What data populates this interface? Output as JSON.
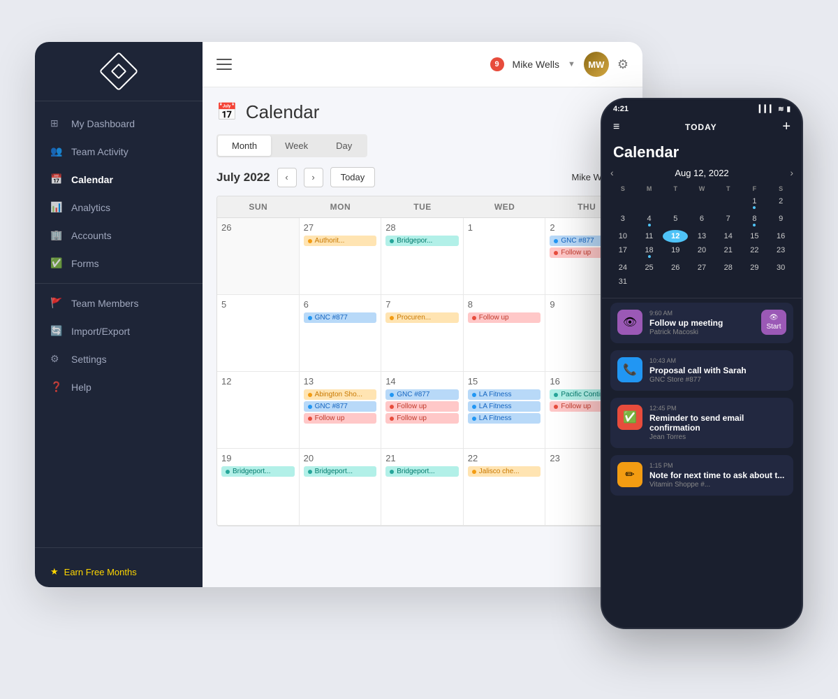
{
  "app": {
    "title": "Calendar"
  },
  "sidebar": {
    "logo_label": "App Logo",
    "nav_items": [
      {
        "id": "dashboard",
        "label": "My Dashboard",
        "icon": "⊞"
      },
      {
        "id": "team-activity",
        "label": "Team Activity",
        "icon": "👥",
        "active": false
      },
      {
        "id": "calendar",
        "label": "Calendar",
        "icon": "📅",
        "active": true
      },
      {
        "id": "analytics",
        "label": "Analytics",
        "icon": "📊"
      },
      {
        "id": "accounts",
        "label": "Accounts",
        "icon": "🏢"
      },
      {
        "id": "forms",
        "label": "Forms",
        "icon": "✅"
      }
    ],
    "bottom_items": [
      {
        "id": "team-members",
        "label": "Team Members",
        "icon": "👥"
      },
      {
        "id": "import-export",
        "label": "Import/Export",
        "icon": "🔄"
      },
      {
        "id": "settings",
        "label": "Settings",
        "icon": "⚙"
      },
      {
        "id": "help",
        "label": "Help",
        "icon": "❓"
      }
    ],
    "earn_label": "Earn Free Months"
  },
  "topbar": {
    "notification_count": "9",
    "user_name": "Mike Wells",
    "user_initials": "MW"
  },
  "calendar": {
    "title": "Calendar",
    "tabs": [
      "Month",
      "Week",
      "Day"
    ],
    "active_tab": "Month",
    "current_month": "July 2022",
    "today_label": "Today",
    "filter_user": "Mike Wells",
    "day_headers": [
      "SUN",
      "MON",
      "TUE",
      "WED",
      "THU"
    ],
    "weeks": [
      {
        "days": [
          {
            "date": "26",
            "other_month": true,
            "events": []
          },
          {
            "date": "27",
            "events": [
              {
                "label": "Authorit...",
                "type": "orange"
              }
            ]
          },
          {
            "date": "28",
            "events": [
              {
                "label": "Bridgepor...",
                "type": "teal"
              }
            ]
          },
          {
            "date": "1",
            "events": []
          },
          {
            "date": "2",
            "events": [
              {
                "label": "GNC #877",
                "type": "blue"
              },
              {
                "label": "Follow up",
                "type": "red"
              }
            ]
          }
        ]
      },
      {
        "days": [
          {
            "date": "5",
            "events": []
          },
          {
            "date": "6",
            "events": [
              {
                "label": "GNC #877",
                "type": "blue"
              }
            ]
          },
          {
            "date": "7",
            "events": [
              {
                "label": "Procuren...",
                "type": "orange"
              }
            ]
          },
          {
            "date": "8",
            "events": [
              {
                "label": "Follow up",
                "type": "red"
              }
            ]
          },
          {
            "date": "9",
            "events": []
          }
        ]
      },
      {
        "days": [
          {
            "date": "12",
            "events": []
          },
          {
            "date": "13",
            "events": [
              {
                "label": "Abington Sho...",
                "type": "orange"
              },
              {
                "label": "GNC #877",
                "type": "blue"
              },
              {
                "label": "Follow up",
                "type": "red"
              }
            ]
          },
          {
            "date": "14",
            "events": [
              {
                "label": "GNC #877",
                "type": "blue"
              },
              {
                "label": "Follow up",
                "type": "red"
              },
              {
                "label": "Follow up",
                "type": "red"
              }
            ]
          },
          {
            "date": "15",
            "events": [
              {
                "label": "LA Fitness",
                "type": "blue"
              },
              {
                "label": "LA Fitness",
                "type": "blue"
              },
              {
                "label": "LA Fitness",
                "type": "blue"
              }
            ]
          },
          {
            "date": "16",
            "events": [
              {
                "label": "Pacific Contin...",
                "type": "teal"
              },
              {
                "label": "Follow up",
                "type": "red"
              }
            ]
          }
        ]
      },
      {
        "days": [
          {
            "date": "19",
            "events": [
              {
                "label": "Bridgeport...",
                "type": "teal"
              }
            ]
          },
          {
            "date": "20",
            "events": [
              {
                "label": "Bridgeport...",
                "type": "teal"
              }
            ]
          },
          {
            "date": "21",
            "events": [
              {
                "label": "Bridgeport...",
                "type": "teal"
              }
            ]
          },
          {
            "date": "22",
            "events": [
              {
                "label": "Jalisco che...",
                "type": "orange"
              }
            ]
          },
          {
            "date": "23",
            "events": []
          }
        ]
      }
    ]
  },
  "mobile": {
    "status_time": "4:21",
    "status_signal": "▎▎▎",
    "status_wifi": "WiFi",
    "status_battery": "🔋",
    "today_label": "TODAY",
    "cal_title": "Calendar",
    "mini_cal_month": "Aug 12, 2022",
    "day_headers": [
      "S",
      "M",
      "T",
      "W",
      "T",
      "F",
      "S"
    ],
    "mini_cal_rows": [
      [
        "",
        "",
        "",
        "",
        "",
        "1",
        "2"
      ],
      [
        "3",
        "4",
        "5",
        "6",
        "7",
        "8",
        "9"
      ],
      [
        "10",
        "11",
        "12",
        "13",
        "14",
        "15",
        "16"
      ],
      [
        "17",
        "18",
        "19",
        "20",
        "21",
        "22",
        "23"
      ],
      [
        "24",
        "25",
        "26",
        "27",
        "28",
        "29",
        "30"
      ],
      [
        "31",
        "",
        "",
        "",
        "",
        "",
        ""
      ]
    ],
    "today_date": "12",
    "events": [
      {
        "color": "#9b59b6",
        "icon": "👁",
        "time": "9:60 AM",
        "name": "Follow up meeting",
        "sub": "Patrick Macoski",
        "action_color": "#9b59b6",
        "action_label": "Start"
      },
      {
        "color": "#2196f3",
        "icon": "📞",
        "time": "10:43 AM",
        "name": "Proposal call with Sarah",
        "sub": "GNC Store #877",
        "action_color": null
      },
      {
        "color": "#e74c3c",
        "icon": "✅",
        "time": "12:45 PM",
        "name": "Reminder to send email confirmation",
        "sub": "Jean Torres",
        "action_color": null
      },
      {
        "color": "#f39c12",
        "icon": "✏",
        "time": "1:15 PM",
        "name": "Note for next time to ask about t...",
        "sub": "Vitamin Shoppe #...",
        "action_color": null
      }
    ]
  }
}
